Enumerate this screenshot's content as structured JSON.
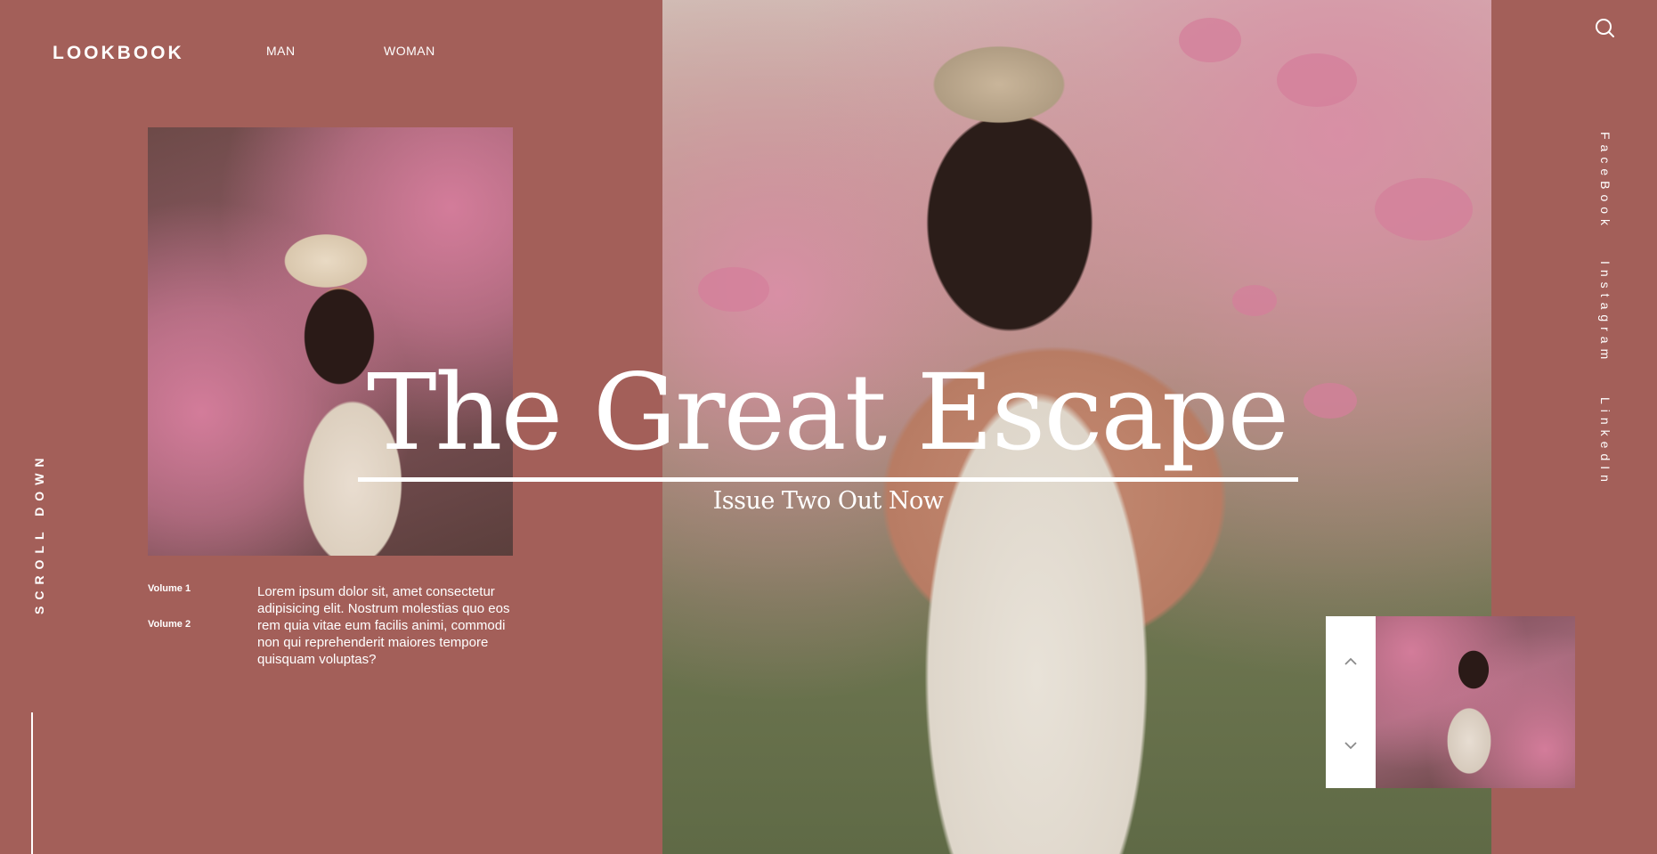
{
  "header": {
    "logo": "LOOKBOOK",
    "nav": [
      {
        "label": "MAN"
      },
      {
        "label": "WOMAN"
      }
    ],
    "search_icon": "search-icon"
  },
  "hero": {
    "title": "The Great Escape",
    "subtitle": "Issue Two Out Now"
  },
  "volumes": [
    {
      "label": "Volume 1"
    },
    {
      "label": "Volume 2"
    }
  ],
  "description": "Lorem ipsum dolor sit, amet consectetur adipisicing elit. Nostrum molestias quo eos rem quia vitae eum facilis animi, commodi non qui reprehenderit maiores tempore quisquam voluptas?",
  "scroll": {
    "label": "SCROLL DOWN"
  },
  "social": [
    {
      "label": "FaceBook"
    },
    {
      "label": "Instagram"
    },
    {
      "label": "LinkedIn"
    }
  ],
  "slider": {
    "up_icon": "chevron-up-icon",
    "down_icon": "chevron-down-icon"
  },
  "colors": {
    "background": "#a35f59",
    "text": "#ffffff"
  }
}
